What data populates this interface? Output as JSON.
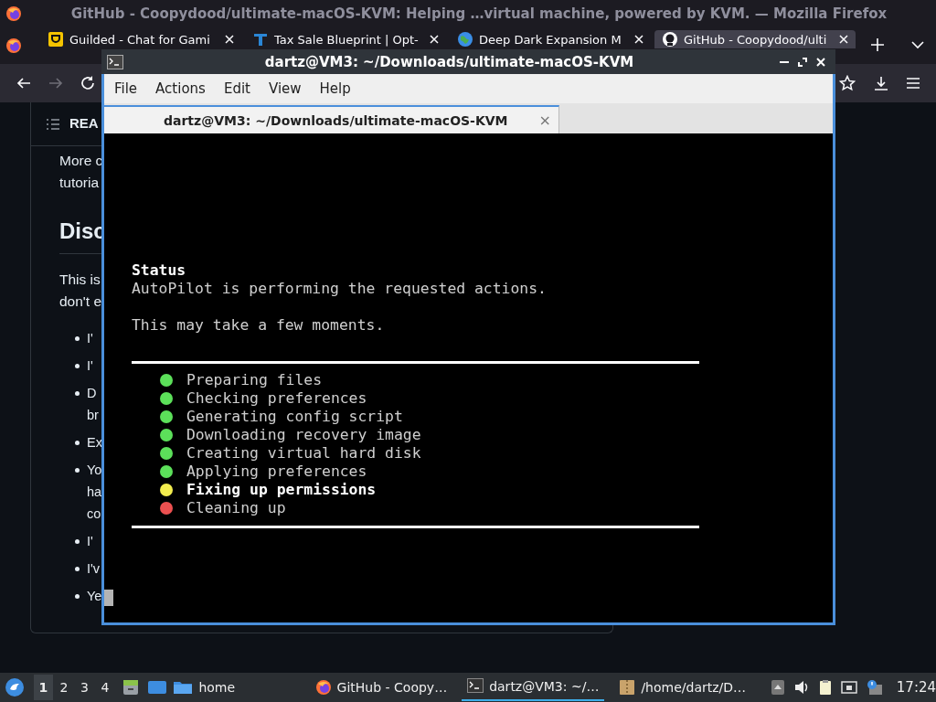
{
  "browser": {
    "title": "GitHub - Coopydood/ultimate-macOS-KVM: Helping …virtual machine, powered by KVM. — Mozilla Firefox",
    "tabs": [
      {
        "label": "Guilded - Chat for Gami",
        "kind": "guilded",
        "selected": false
      },
      {
        "label": "Tax Sale Blueprint | Opt-",
        "kind": "letter",
        "selected": false
      },
      {
        "label": "Deep Dark Expansion M",
        "kind": "globe",
        "selected": false
      },
      {
        "label": "GitHub - Coopydood/ulti",
        "kind": "github",
        "selected": true
      }
    ]
  },
  "readme": {
    "header": "REA",
    "paragraphs": [
      [
        "More c",
        "tutoria"
      ]
    ],
    "heading": "Disc",
    "intro": [
      "This is",
      "don't e"
    ],
    "bullets": [
      [
        "I'"
      ],
      [
        "I'"
      ],
      [
        "D",
        "br"
      ],
      [
        "Ex"
      ],
      [
        "Yo",
        "ha",
        "co"
      ],
      [
        "I'"
      ],
      [
        "I'v"
      ],
      [
        "Ye"
      ]
    ]
  },
  "terminal": {
    "title": "dartz@VM3: ~/Downloads/ultimate-macOS-KVM",
    "menu": [
      "File",
      "Actions",
      "Edit",
      "View",
      "Help"
    ],
    "tab": "dartz@VM3: ~/Downloads/ultimate-macOS-KVM",
    "tab_close": "×",
    "heading": "Status",
    "lines": [
      "AutoPilot is performing the requested actions."
    ],
    "note": "This may take a few moments.",
    "steps": [
      {
        "label": "Preparing files",
        "color": "#5ce05a",
        "current": false
      },
      {
        "label": "Checking preferences",
        "color": "#5ce05a",
        "current": false
      },
      {
        "label": "Generating config script",
        "color": "#5ce05a",
        "current": false
      },
      {
        "label": "Downloading recovery image",
        "color": "#5ce05a",
        "current": false
      },
      {
        "label": "Creating virtual hard disk",
        "color": "#5ce05a",
        "current": false
      },
      {
        "label": "Applying preferences",
        "color": "#5ce05a",
        "current": false
      },
      {
        "label": "Fixing up permissions",
        "color": "#f2ec4e",
        "current": true
      },
      {
        "label": "Cleaning up",
        "color": "#ec5050",
        "current": false
      }
    ]
  },
  "taskbar": {
    "workspaces": [
      {
        "label": "1",
        "selected": true
      },
      {
        "label": "2",
        "selected": false
      },
      {
        "label": "3",
        "selected": false
      },
      {
        "label": "4",
        "selected": false
      }
    ],
    "places": [
      {
        "label": "home"
      }
    ],
    "tasks": [
      {
        "label": "GitHub - Coopy…",
        "kind": "firefox",
        "selected": false
      },
      {
        "label": "dartz@VM3: ~/…",
        "kind": "terminal",
        "selected": true
      },
      {
        "label": "/home/dartz/D…",
        "kind": "archive",
        "selected": false
      }
    ],
    "clock": "17:24"
  }
}
